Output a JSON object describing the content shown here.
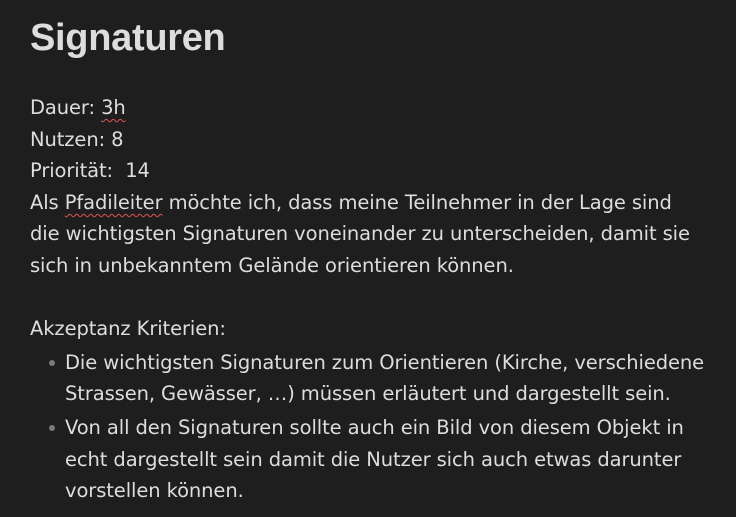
{
  "title": "Signaturen",
  "fields": {
    "dauer_label": "Dauer:",
    "dauer_value": "3h",
    "nutzen_label": "Nutzen:",
    "nutzen_value": "8",
    "prioritaet_label": "Priorität:",
    "prioritaet_value": "14"
  },
  "story": {
    "part1": "Als ",
    "role": "Pfadileiter",
    "part2": " möchte ich, dass meine Teilnehmer in der Lage sind die wichtigsten Signaturen voneinander zu unterscheiden, damit sie sich in unbekanntem Gelände orientieren können."
  },
  "criteria": {
    "heading": "Akzeptanz Kriterien:",
    "items": [
      "Die wichtigsten Signaturen zum Orientieren (Kirche, verschiedene Strassen, Gewässer, …) müssen erläutert und dargestellt sein.",
      "Von all den Signaturen sollte auch ein Bild von diesem Objekt in echt dargestellt sein damit die Nutzer sich auch etwas darunter vorstellen können."
    ]
  },
  "colors": {
    "background": "#1e1e1e",
    "text": "#dcddde",
    "spellcheck_underline": "#e05252",
    "bullet": "#7a7a7a"
  }
}
